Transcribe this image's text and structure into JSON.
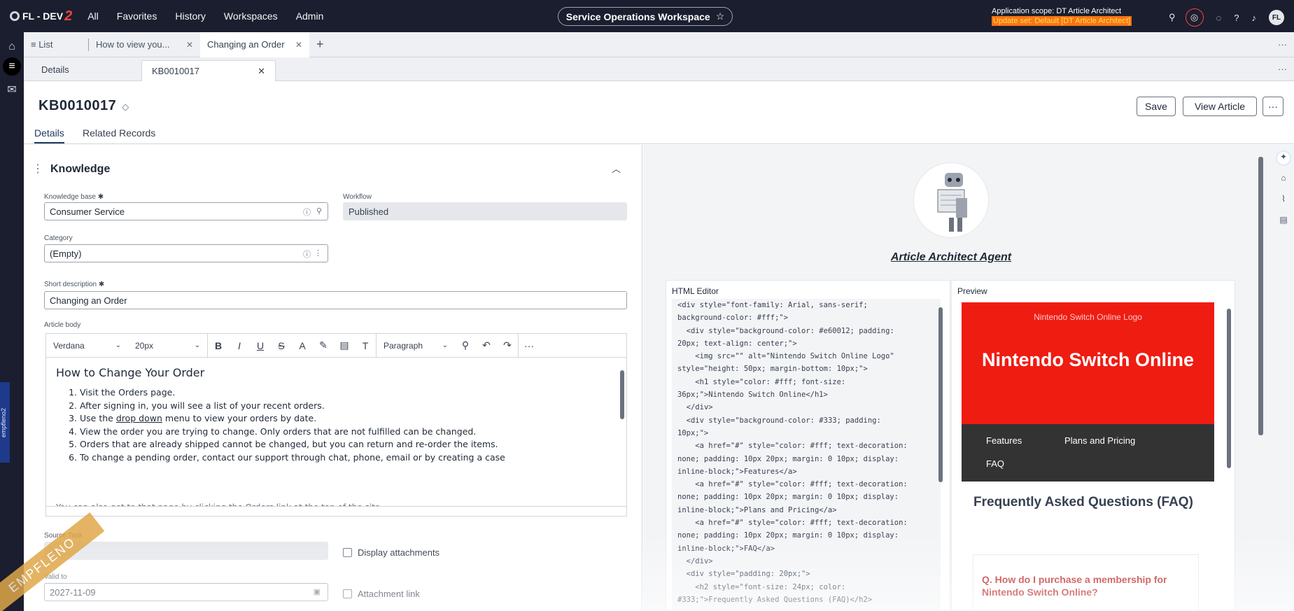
{
  "topbar": {
    "logo_text": "FL - DEV",
    "logo_num": "2",
    "nav": [
      "All",
      "Favorites",
      "History",
      "Workspaces",
      "Admin"
    ],
    "workspace": "Service Operations Workspace",
    "scope_line": "Application scope: DT Article Architect",
    "update_line": "Update set: Default [DT Article Architect]",
    "avatar": "FL",
    "icons": [
      "search-icon",
      "globe-icon",
      "chat-icon",
      "help-icon",
      "bell-icon"
    ]
  },
  "tabs": {
    "list": "List",
    "tab1": "How to view you...",
    "tab2": "Changing an Order"
  },
  "subtabs": {
    "details": "Details",
    "record": "KB0010017"
  },
  "record": {
    "number": "KB0010017",
    "save": "Save",
    "view_article": "View Article",
    "more": "···"
  },
  "formtabs": {
    "details": "Details",
    "related": "Related Records"
  },
  "form": {
    "section": "Knowledge",
    "knowledge_base_label": "Knowledge base",
    "knowledge_base": "Consumer Service",
    "workflow_label": "Workflow",
    "workflow": "Published",
    "category_label": "Category",
    "category": "(Empty)",
    "short_desc_label": "Short description",
    "short_desc": "Changing an Order",
    "article_body_label": "Article body",
    "source_task_label": "Source Task",
    "source_task": "--",
    "display_attachments": "Display attachments",
    "valid_to_label": "Valid to",
    "valid_to": "2027-11-09",
    "attachment_link": "Attachment link"
  },
  "editor": {
    "font": "Verdana",
    "size": "20px",
    "block": "Paragraph",
    "heading": "How to Change Your Order",
    "items": [
      "Visit the Orders page.",
      "After signing in, you will see a list of your recent orders."
    ],
    "item3_pre": "Use the ",
    "item3_link": "drop down",
    "item3_post": " menu to view your orders by date.",
    "items_rest": [
      "View the order you are trying to change. Only orders that are not fulfilled can be changed.",
      "Orders that are already shipped cannot be changed, but you can return and re-order the items.",
      "To change a pending order, contact our support through chat, phone, email or by creating a case"
    ],
    "cut_line": "You can also get to that page by clicking the Orders link at the top of the site"
  },
  "agent": {
    "title": "Article Architect Agent",
    "html_editor_label": "HTML Editor",
    "preview_label": "Preview",
    "code": "<div style=\"font-family: Arial, sans-serif;\nbackground-color: #fff;\">\n  <div style=\"background-color: #e60012; padding:\n20px; text-align: center;\">\n    <img src=\"\" alt=\"Nintendo Switch Online Logo\"\nstyle=\"height: 50px; margin-bottom: 10px;\">\n    <h1 style=\"color: #fff; font-size:\n36px;\">Nintendo Switch Online</h1>\n  </div>\n  <div style=\"background-color: #333; padding:\n10px;\">\n    <a href=\"#\" style=\"color: #fff; text-decoration:\nnone; padding: 10px 20px; margin: 0 10px; display:\ninline-block;\">Features</a>\n    <a href=\"#\" style=\"color: #fff; text-decoration:\nnone; padding: 10px 20px; margin: 0 10px; display:\ninline-block;\">Plans and Pricing</a>\n    <a href=\"#\" style=\"color: #fff; text-decoration:\nnone; padding: 10px 20px; margin: 0 10px; display:\ninline-block;\">FAQ</a>\n  </div>\n  <div style=\"padding: 20px;\">\n    <h2 style=\"font-size: 24px; color:\n#333;\">Frequently Asked Questions (FAQ)</h2>",
    "preview": {
      "logo_alt": "Nintendo Switch Online Logo",
      "h1": "Nintendo Switch Online",
      "nav": [
        "Features",
        "Plans and Pricing",
        "FAQ"
      ],
      "faq_title": "Frequently Asked Questions (FAQ)",
      "question": "Q. How do I purchase a membership for Nintendo Switch Online?"
    }
  },
  "watermark": "EMPFLENO",
  "side_badge": "empfleno2"
}
